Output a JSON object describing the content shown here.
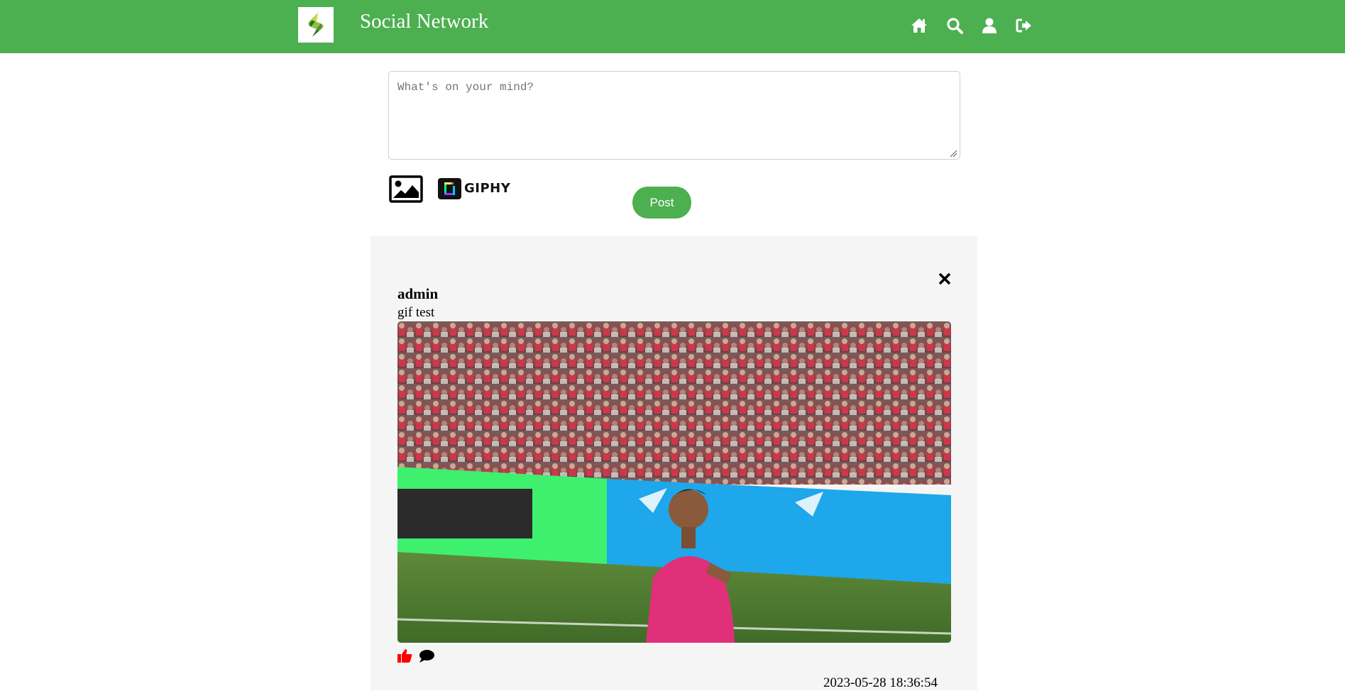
{
  "header": {
    "title": "Social Network",
    "brand_color": "#4caf50",
    "nav_icons": [
      "home-icon",
      "search-icon",
      "user-icon",
      "logout-icon"
    ]
  },
  "composer": {
    "placeholder": "What's on your mind?",
    "value": "",
    "image_upload_icon": "image-icon",
    "giphy_label": "GIPHY",
    "post_label": "Post"
  },
  "post": {
    "author": "admin",
    "text": "gif test",
    "timestamp": "2023-05-28 18:36:54",
    "actions": [
      "like-icon",
      "comment-icon"
    ],
    "like_color": "#ff0000"
  }
}
